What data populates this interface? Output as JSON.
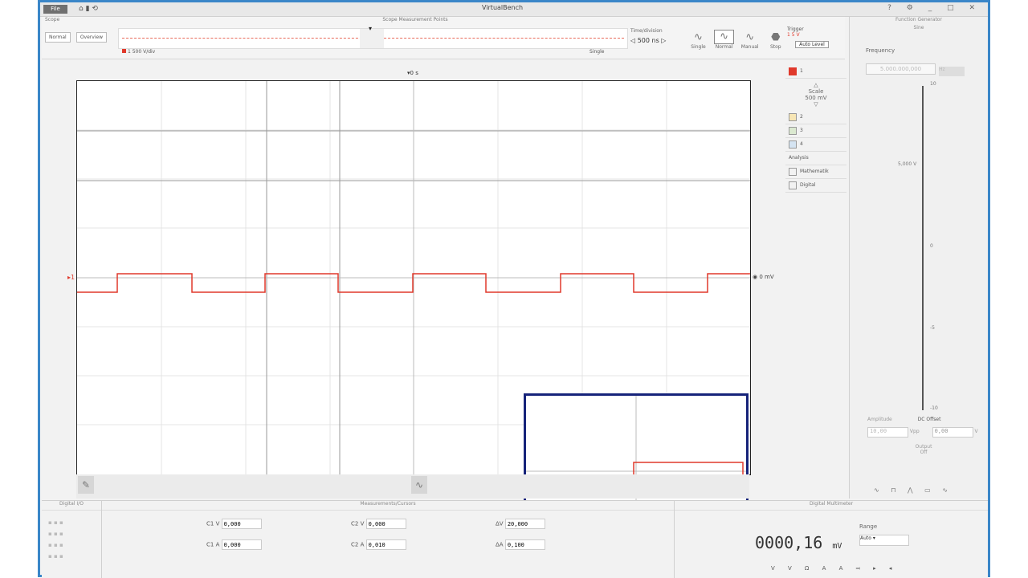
{
  "app": {
    "title": "VirtualBench",
    "menu_label": "File"
  },
  "top": {
    "mode_header": "Scope",
    "mode_buttons": [
      "Normal",
      "Overview"
    ],
    "overview_header": "Scope Measurement Points",
    "channel_legend": "1 500 V/div",
    "single_label": "Single",
    "timebase_label": "Time/division",
    "timebase_value": "500 ns",
    "acq_modes": [
      "Single",
      "Normal",
      "Manual",
      "Stop"
    ],
    "trigger_label": "Trigger",
    "trigger_source": "1 5 V",
    "trigger_button": "Auto Level"
  },
  "scope": {
    "trigger_time": "0 s",
    "right_level": "0 mV",
    "ground_marker": "1"
  },
  "channels": {
    "items": [
      "1",
      "2",
      "3",
      "4"
    ],
    "scale_label": "Scale",
    "scale_value": "500 mV",
    "math_header": "Analysis",
    "math_label": "Mathematik",
    "digital_label": "Digital"
  },
  "generator": {
    "header": "Function Generator",
    "sub": "Sine",
    "freq_label": "Frequency",
    "freq_value": "5.000.000,000",
    "freq_unit": "Hz",
    "mid_label": "5,000 V",
    "tick_top": "10",
    "tick_mid": "0",
    "tick_low": "-5",
    "tick_bot": "-10",
    "amp_label": "Amplitude",
    "dc_label": "DC Offset",
    "amp_value": "10,00",
    "amp_unit": "Vpp",
    "offset_value": "0,00",
    "offset_unit": "V",
    "output_label": "Output",
    "output_value": "Off"
  },
  "bottom": {
    "digital_header": "Digital I/O",
    "cursors_header": "Measurements/Cursors",
    "dmm_header": "Digital Multimeter",
    "cursor_fields": [
      {
        "label": "C1 V",
        "value": "0,000"
      },
      {
        "label": "C2 V",
        "value": "0,000"
      },
      {
        "label": "ΔV",
        "value": "20,000"
      },
      {
        "label": "C1 A",
        "value": "0,000"
      },
      {
        "label": "C2 A",
        "value": "0,010"
      },
      {
        "label": "ΔA",
        "value": "0,100"
      }
    ],
    "dmm_value": "0000,16",
    "dmm_unit": "mV",
    "dmm_range_label": "Range",
    "dmm_range_value": "Auto",
    "dmm_modes": "V V Ω A A ⫤ ▸ ◂"
  },
  "colors": {
    "channel1": "#e0392b",
    "zoom_border": "#16237a",
    "accent": "#3a86c8"
  }
}
